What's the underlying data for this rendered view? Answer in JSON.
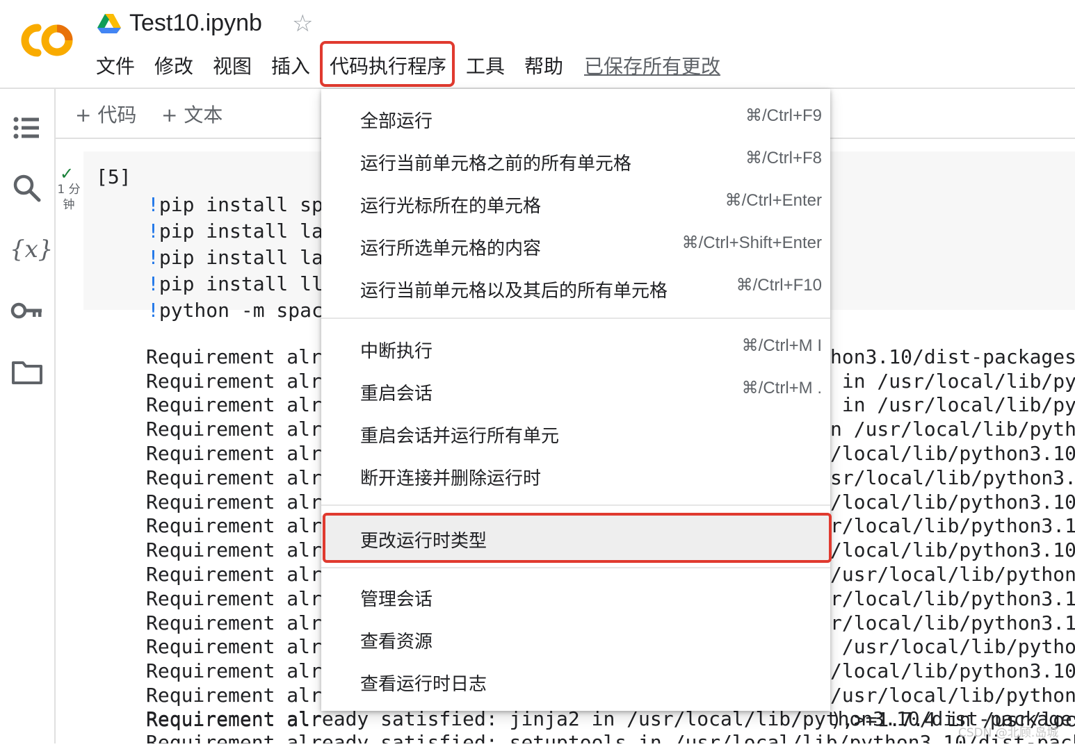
{
  "header": {
    "notebook_title": "Test10.ipynb",
    "menus": [
      "文件",
      "修改",
      "视图",
      "插入",
      "代码执行程序",
      "工具",
      "帮助"
    ],
    "saved_status": "已保存所有更改"
  },
  "toolbar": {
    "add_code": "+ 代码",
    "add_text": "+ 文本"
  },
  "rail": {
    "icons": [
      "toc-icon",
      "search-icon",
      "variables-icon",
      "key-icon",
      "folder-icon"
    ],
    "variables_glyph": "{x}"
  },
  "cell": {
    "status": "✓",
    "exec_time": "1 分钟",
    "prompt": "[5]",
    "code_lines": [
      {
        "bang": "!",
        "text": "pip install sp"
      },
      {
        "bang": "!",
        "text": "pip install la"
      },
      {
        "bang": "!",
        "text": "pip install la"
      },
      {
        "bang": "!",
        "text": "pip install ll"
      },
      {
        "bang": "!",
        "text": "python -m spac"
      }
    ]
  },
  "output": {
    "left_lines": [
      "Requirement alr",
      "Requirement alr",
      "Requirement alr",
      "Requirement alr",
      "Requirement alr",
      "Requirement alr",
      "Requirement alr",
      "Requirement alr",
      "Requirement alr",
      "Requirement alr",
      "Requirement alr",
      "Requirement alr",
      "Requirement alr",
      "Requirement alr",
      "Requirement alr",
      "Requirement alr"
    ],
    "right_lines": [
      "hon3.10/dist-packages",
      " in /usr/local/lib/pyt",
      " in /usr/local/lib/pyt",
      "n /usr/local/lib/pytho",
      "/local/lib/python3.10/",
      "sr/local/lib/python3.1",
      "/local/lib/python3.10/",
      "r/local/lib/python3.10",
      "/local/lib/python3.10/",
      "/usr/local/lib/python3",
      "r/local/lib/python3.10",
      "r/local/lib/python3.10",
      " /usr/local/lib/python",
      "/local/lib/python3.10/",
      "/usr/local/lib/python3",
      "),>=1.7.4 in /usr/loca"
    ],
    "full_lines": [
      "Requirement already satisfied: jinja2 in /usr/local/lib/python3.10/dist-packages",
      "Requirement already satisfied: setuptools in /usr/local/lib/python3.10/dist-pack"
    ]
  },
  "dropdown": {
    "items": [
      {
        "label": "全部运行",
        "shortcut": "⌘/Ctrl+F9"
      },
      {
        "label": "运行当前单元格之前的所有单元格",
        "shortcut": "⌘/Ctrl+F8"
      },
      {
        "label": "运行光标所在的单元格",
        "shortcut": "⌘/Ctrl+Enter"
      },
      {
        "label": "运行所选单元格的内容",
        "shortcut": "⌘/Ctrl+Shift+Enter"
      },
      {
        "label": "运行当前单元格以及其后的所有单元格",
        "shortcut": "⌘/Ctrl+F10"
      },
      {
        "label": "中断执行",
        "shortcut": "⌘/Ctrl+M I"
      },
      {
        "label": "重启会话",
        "shortcut": "⌘/Ctrl+M ."
      },
      {
        "label": "重启会话并运行所有单元",
        "shortcut": ""
      },
      {
        "label": "断开连接并删除运行时",
        "shortcut": ""
      },
      {
        "label": "更改运行时类型",
        "shortcut": ""
      },
      {
        "label": "管理会话",
        "shortcut": ""
      },
      {
        "label": "查看资源",
        "shortcut": ""
      },
      {
        "label": "查看运行时日志",
        "shortcut": ""
      }
    ]
  },
  "watermark": "CSDN @北顾.岛城",
  "colors": {
    "highlight_red": "#e03a2f",
    "logo_orange": "#f9ab00",
    "logo_dark_orange": "#e8710a",
    "bang_blue": "#1a73e8",
    "check_green": "#188038"
  }
}
